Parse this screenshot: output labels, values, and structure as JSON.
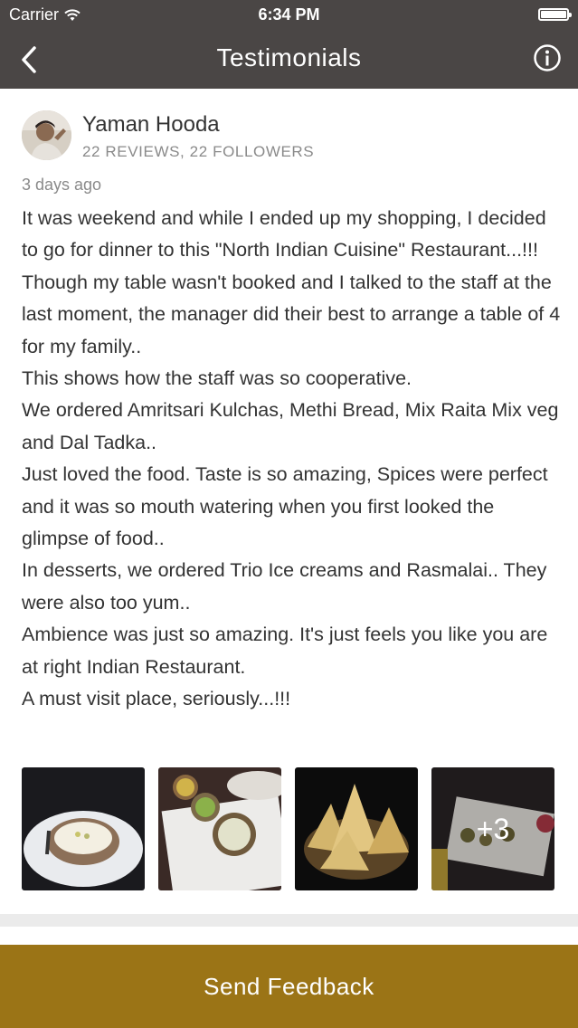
{
  "status_bar": {
    "carrier": "Carrier",
    "time": "6:34 PM"
  },
  "nav": {
    "title": "Testimonials",
    "back_icon": "chevron-left-icon",
    "info_icon": "info-icon"
  },
  "review": {
    "user_name": "Yaman Hooda",
    "user_stats": "22 REVIEWS, 22 FOLLOWERS",
    "timestamp": "3 days ago",
    "lines": [
      "It was weekend and while I ended up my shopping, I decided to go for dinner to this \"North Indian Cuisine\" Restaurant...!!!",
      "Though my table wasn't booked and I talked to the staff at the last moment, the manager did their best to arrange a table of 4 for my family..",
      "This shows how the staff was so cooperative.",
      "We ordered Amritsari Kulchas, Methi Bread, Mix Raita Mix veg and Dal Tadka..",
      "Just loved the food. Taste is so amazing, Spices were perfect and it was so mouth watering when you  first looked the glimpse of food..",
      "In desserts, we ordered Trio Ice creams and Rasmalai.. They were also too yum..",
      "Ambience was just so amazing. It's just feels you like you are at right Indian Restaurant.",
      "A must visit place, seriously...!!!"
    ],
    "photos_more_count": "+3"
  },
  "footer": {
    "button_label": "Send Feedback"
  },
  "colors": {
    "header_bg": "#4a4645",
    "button_bg": "#9b7416"
  }
}
